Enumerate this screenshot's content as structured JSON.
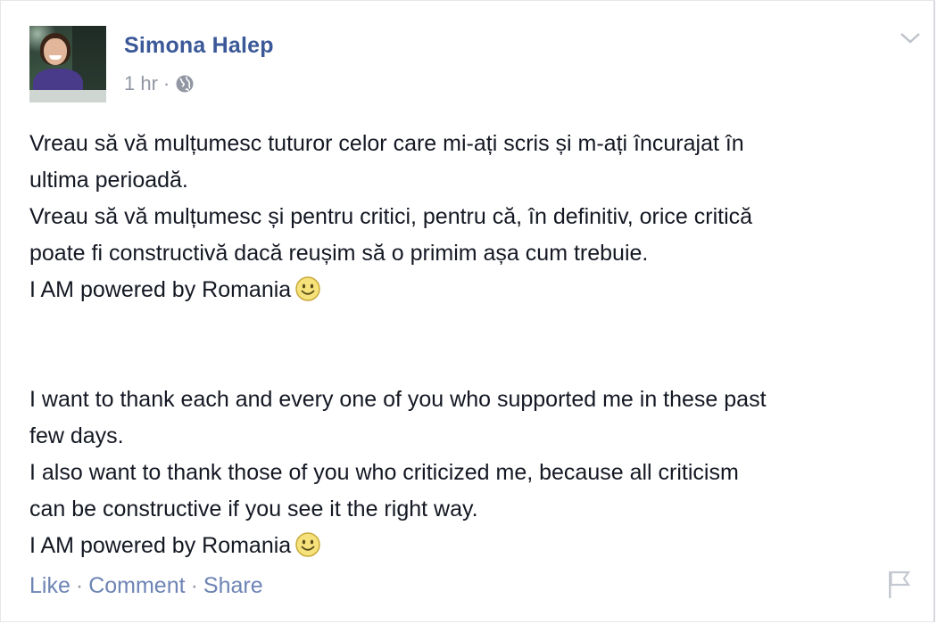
{
  "post": {
    "author": "Simona Halep",
    "time": "1 hr",
    "separator": "·",
    "audience_icon": "globe-icon",
    "menu_icon": "chevron-down-icon",
    "paragraphs_ro": [
      "Vreau să vă mulțumesc tuturor celor care mi-ați scris și m-ați încurajat în",
      "ultima perioadă.",
      "Vreau să vă mulțumesc și pentru critici, pentru că, în definitiv, orice critică",
      "poate fi constructivă dacă reușim să o primim așa cum trebuie.",
      "I AM powered by Romania"
    ],
    "paragraphs_en": [
      "I want to thank each and every one of you who supported me in these past",
      "few days.",
      "I also want to thank those of you who criticized me, because all criticism",
      "can be constructive if you see it the right way.",
      "I AM powered by Romania"
    ],
    "emoji": "smiley-emoji"
  },
  "actions": {
    "like": "Like",
    "comment": "Comment",
    "share": "Share",
    "separator": "·",
    "report_icon": "flag-icon"
  },
  "colors": {
    "author_link": "#3b5998",
    "action_link": "#6d84b4",
    "meta_text": "#9197a3",
    "body_text": "#141823"
  }
}
